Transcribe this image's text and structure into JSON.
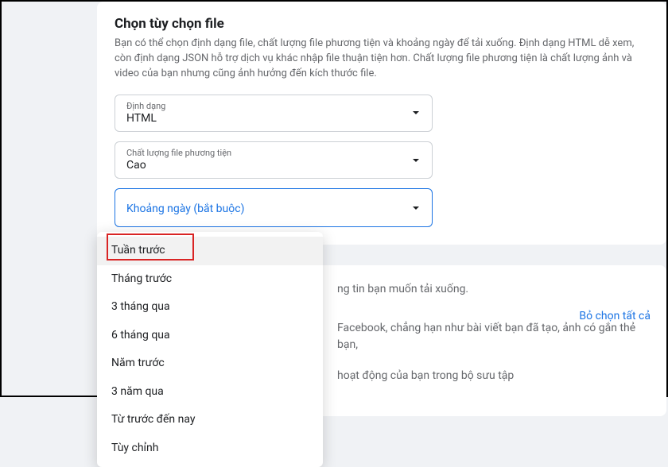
{
  "header": {
    "title": "Chọn tùy chọn file",
    "desc": "Bạn có thể chọn định dạng file, chất lượng file phương tiện và khoảng ngày để tải xuống. Định dạng HTML dễ xem, còn định dạng JSON hỗ trợ dịch vụ khác nhập file thuận tiện hơn. Chất lượng file phương tiện là chất lượng ảnh và video của bạn nhưng cũng ảnh hưởng đến kích thước file."
  },
  "fields": {
    "format": {
      "label": "Định dạng",
      "value": "HTML"
    },
    "quality": {
      "label": "Chất lượng file phương tiện",
      "value": "Cao"
    },
    "dateRange": {
      "placeholder": "Khoảng ngày (bắt buộc)"
    }
  },
  "dropdown": {
    "items": [
      "Tuần trước",
      "Tháng trước",
      "3 tháng qua",
      "6 tháng qua",
      "Năm trước",
      "3 năm qua",
      "Từ trước đến nay",
      "Tùy chỉnh"
    ]
  },
  "lower": {
    "partial1": "ng tin bạn muốn tải xuống.",
    "deselectAll": "Bỏ chọn tất cả",
    "partial2": "Facebook, chẳng hạn như bài viết bạn đã tạo, ảnh có gắn thẻ bạn,",
    "partial3": "hoạt động của bạn trong bộ sưu tập"
  }
}
